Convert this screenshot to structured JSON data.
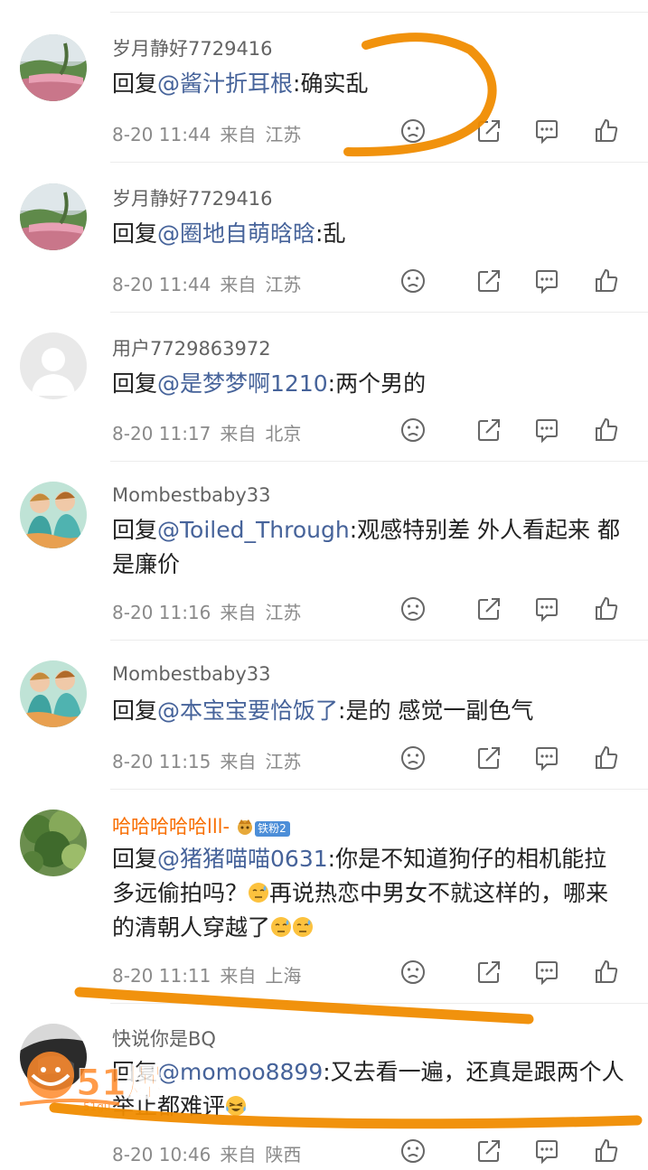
{
  "comments": [
    {
      "username": "岁月静好7729416",
      "vip": false,
      "badge": "",
      "reply_prefix": "回复",
      "mention": "@酱汁折耳根",
      "text": ":确实乱",
      "time": "8-20 11:44",
      "from_label": "来自",
      "location": "江苏",
      "avatar": "landscape"
    },
    {
      "username": "岁月静好7729416",
      "vip": false,
      "badge": "",
      "reply_prefix": "回复",
      "mention": "@圈地自萌晗晗",
      "text": ":乱",
      "time": "8-20 11:44",
      "from_label": "来自",
      "location": "江苏",
      "avatar": "landscape"
    },
    {
      "username": "用户7729863972",
      "vip": false,
      "badge": "",
      "reply_prefix": "回复",
      "mention": "@是梦梦啊1210",
      "text": ":两个男的",
      "time": "8-20 11:17",
      "from_label": "来自",
      "location": "北京",
      "avatar": "default"
    },
    {
      "username": "Mombestbaby33",
      "vip": false,
      "badge": "",
      "reply_prefix": "回复",
      "mention": "@Toiled_Through",
      "text": ":观感特别差 外人看起来  都是廉价",
      "time": "8-20 11:16",
      "from_label": "来自",
      "location": "江苏",
      "avatar": "anime"
    },
    {
      "username": "Mombestbaby33",
      "vip": false,
      "badge": "",
      "reply_prefix": "回复",
      "mention": "@本宝宝要恰饭了",
      "text": ":是的 感觉一副色气",
      "time": "8-20 11:15",
      "from_label": "来自",
      "location": "江苏",
      "avatar": "anime"
    },
    {
      "username": "哈哈哈哈哈lll-",
      "vip": true,
      "badge": "铁粉2",
      "reply_prefix": "回复",
      "mention": "@猪猪喵喵0631",
      "text": ":你是不知道狗仔的相机能拉多远偷拍吗？",
      "text_after_emoji": "再说热恋中男女不就这样的，哪来的清朝人穿越了",
      "emoji": "sweat-emoji",
      "time": "8-20 11:11",
      "from_label": "来自",
      "location": "上海",
      "avatar": "tree"
    },
    {
      "username": "快说你是BQ",
      "vip": false,
      "badge": "",
      "reply_prefix": "回复",
      "mention": "@momoo8899",
      "text": ":又去看一遍，还真是跟两个人举止都难评",
      "emoji": "laugh-cry-emoji",
      "time": "8-20 10:46",
      "from_label": "来自",
      "location": "陕西",
      "avatar": "dark"
    }
  ],
  "action_icons": [
    "dislike-face-icon",
    "share-icon",
    "comment-icon",
    "like-icon"
  ],
  "watermark": {
    "text": "51爆",
    "site": "51gu..."
  },
  "colors": {
    "mention": "#46639a",
    "vip_name": "#f86e00",
    "annotation": "#f08c00",
    "meta": "#8a8a8a"
  }
}
